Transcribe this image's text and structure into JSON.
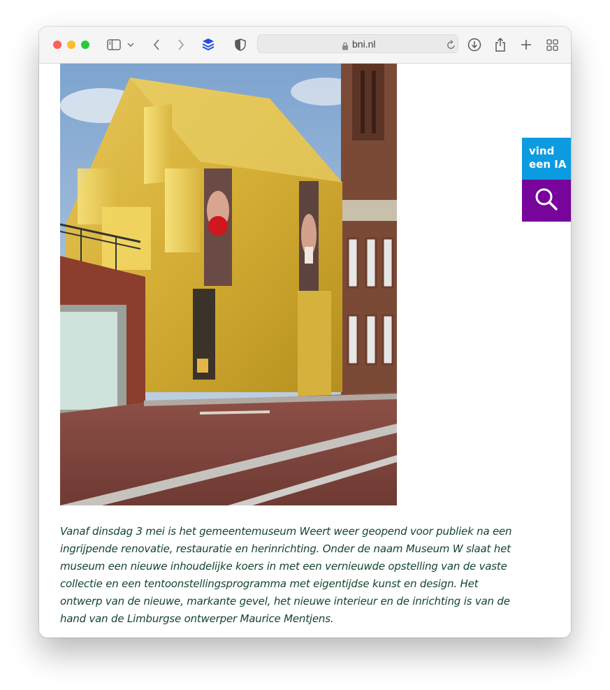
{
  "browser": {
    "url": "bni.nl",
    "icons": [
      "sidebar-icon",
      "chevron-down-icon",
      "back-icon",
      "forward-icon",
      "layers-extension-icon",
      "shield-icon",
      "lock-icon",
      "reload-icon",
      "download-icon",
      "share-icon",
      "new-tab-icon",
      "tab-overview-icon"
    ]
  },
  "side_widget": {
    "line1": "vind",
    "line2": "een IA",
    "search_icon": "search-icon",
    "colors": {
      "vind_bg": "#0c9be0",
      "search_bg": "#77049b"
    }
  },
  "article": {
    "caption": "Vanaf dinsdag 3 mei is het gemeentemuseum Weert weer geopend voor publiek na een ingrijpende renovatie, restauratie en herinrichting. Onder de naam Museum W slaat het museum een nieuwe inhoudelijke koers in met een vernieuwde opstelling van de vaste collectie en een tentoonstellingsprogramma met eigentijdse kunst en design. Het ontwerp van de nieuwe, markante gevel, het nieuwe interieur en de inrichting is van de hand van de Limburgse ontwerper Maurice Mentjens.",
    "caption_color": "#14452c"
  }
}
